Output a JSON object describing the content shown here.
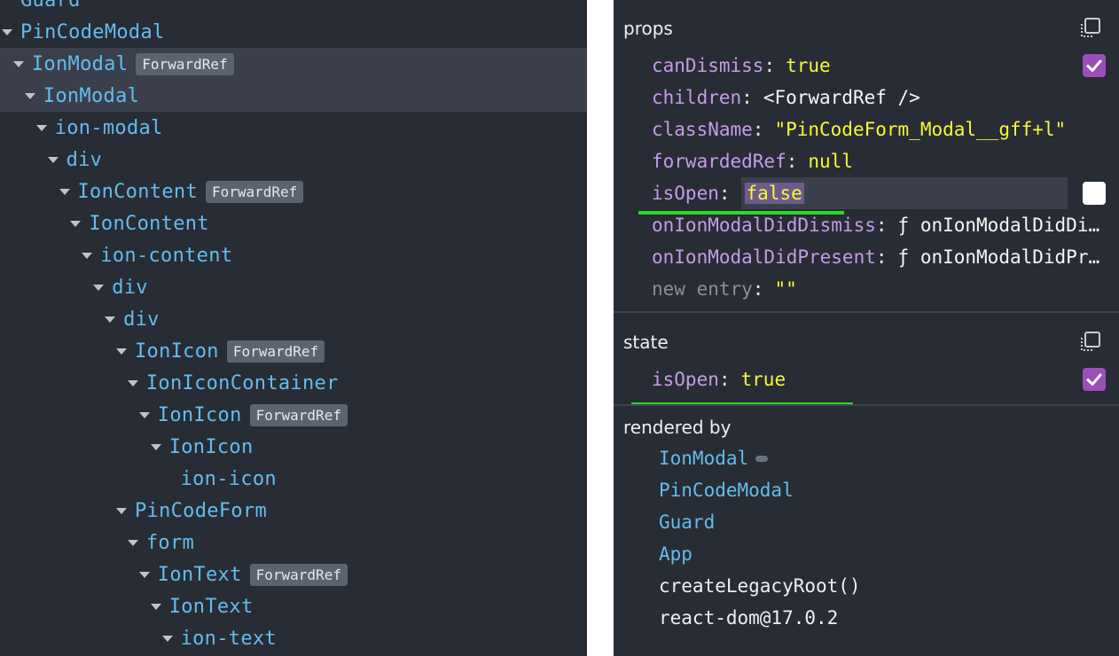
{
  "tree": [
    {
      "label": "Guard",
      "badge": "",
      "depth": 0,
      "arrow": "none",
      "selected": false
    },
    {
      "label": "PinCodeModal",
      "badge": "",
      "depth": 0,
      "arrow": "down",
      "selected": false
    },
    {
      "label": "IonModal",
      "badge": "ForwardRef",
      "depth": 1,
      "arrow": "down",
      "selected": true
    },
    {
      "label": "IonModal",
      "badge": "",
      "depth": 2,
      "arrow": "down",
      "selected": true
    },
    {
      "label": "ion-modal",
      "badge": "",
      "depth": 3,
      "arrow": "down",
      "selected": false
    },
    {
      "label": "div",
      "badge": "",
      "depth": 4,
      "arrow": "down",
      "selected": false
    },
    {
      "label": "IonContent",
      "badge": "ForwardRef",
      "depth": 5,
      "arrow": "down",
      "selected": false
    },
    {
      "label": "IonContent",
      "badge": "",
      "depth": 6,
      "arrow": "down",
      "selected": false
    },
    {
      "label": "ion-content",
      "badge": "",
      "depth": 7,
      "arrow": "down",
      "selected": false
    },
    {
      "label": "div",
      "badge": "",
      "depth": 8,
      "arrow": "down",
      "selected": false
    },
    {
      "label": "div",
      "badge": "",
      "depth": 9,
      "arrow": "down",
      "selected": false
    },
    {
      "label": "IonIcon",
      "badge": "ForwardRef",
      "depth": 10,
      "arrow": "down",
      "selected": false
    },
    {
      "label": "IonIconContainer",
      "badge": "",
      "depth": 11,
      "arrow": "down",
      "selected": false
    },
    {
      "label": "IonIcon",
      "badge": "ForwardRef",
      "depth": 12,
      "arrow": "down",
      "selected": false
    },
    {
      "label": "IonIcon",
      "badge": "",
      "depth": 13,
      "arrow": "down",
      "selected": false
    },
    {
      "label": "ion-icon",
      "badge": "",
      "depth": 14,
      "arrow": "none",
      "selected": false
    },
    {
      "label": "PinCodeForm",
      "badge": "",
      "depth": 10,
      "arrow": "down",
      "selected": false
    },
    {
      "label": "form",
      "badge": "",
      "depth": 11,
      "arrow": "down",
      "selected": false
    },
    {
      "label": "IonText",
      "badge": "ForwardRef",
      "depth": 12,
      "arrow": "down",
      "selected": false
    },
    {
      "label": "IonText",
      "badge": "",
      "depth": 13,
      "arrow": "down",
      "selected": false
    },
    {
      "label": "ion-text",
      "badge": "",
      "depth": 14,
      "arrow": "down",
      "selected": false
    }
  ],
  "props": {
    "title": "props",
    "items": [
      {
        "key": "canDismiss",
        "value": "true",
        "color": "yellow",
        "checkbox": "on"
      },
      {
        "key": "children",
        "value": "<ForwardRef />",
        "color": "white",
        "checkbox": ""
      },
      {
        "key": "className",
        "value": "\"PinCodeForm_Modal__gff+l\"",
        "color": "yellow",
        "checkbox": ""
      },
      {
        "key": "forwardedRef",
        "value": "null",
        "color": "yellow",
        "checkbox": ""
      },
      {
        "key": "isOpen",
        "value": "false",
        "color": "edit",
        "checkbox": "off"
      },
      {
        "key": "onIonModalDidDismiss",
        "value": "ƒ onIonModalDidDismiss() {}",
        "color": "white",
        "checkbox": ""
      },
      {
        "key": "onIonModalDidPresent",
        "value": "ƒ onIonModalDidPresent() {}",
        "color": "white",
        "checkbox": ""
      },
      {
        "key": "new entry",
        "value": "\"\"",
        "color": "yellow",
        "checkbox": "",
        "dim": true
      }
    ]
  },
  "state": {
    "title": "state",
    "items": [
      {
        "key": "isOpen",
        "value": "true",
        "color": "yellow",
        "checkbox": "on"
      }
    ]
  },
  "rendered_by": {
    "title": "rendered by",
    "items": [
      {
        "label": "IonModal",
        "kind": "component",
        "pill": true
      },
      {
        "label": "PinCodeModal",
        "kind": "component",
        "pill": false
      },
      {
        "label": "Guard",
        "kind": "component",
        "pill": false
      },
      {
        "label": "App",
        "kind": "component",
        "pill": false
      },
      {
        "label": "createLegacyRoot()",
        "kind": "plain",
        "pill": false
      },
      {
        "label": "react-dom@17.0.2",
        "kind": "plain",
        "pill": false
      }
    ]
  },
  "colors": {
    "accent_checkbox": "#9a4fb8",
    "component_name": "#62bcf0",
    "prop_key": "#c59ce8",
    "value_yellow": "#f8f83a",
    "annotation_green": "#22dd22"
  },
  "icons": {
    "copy": "copy-icon",
    "check": "check-icon",
    "expand": "triangle-down-icon"
  }
}
